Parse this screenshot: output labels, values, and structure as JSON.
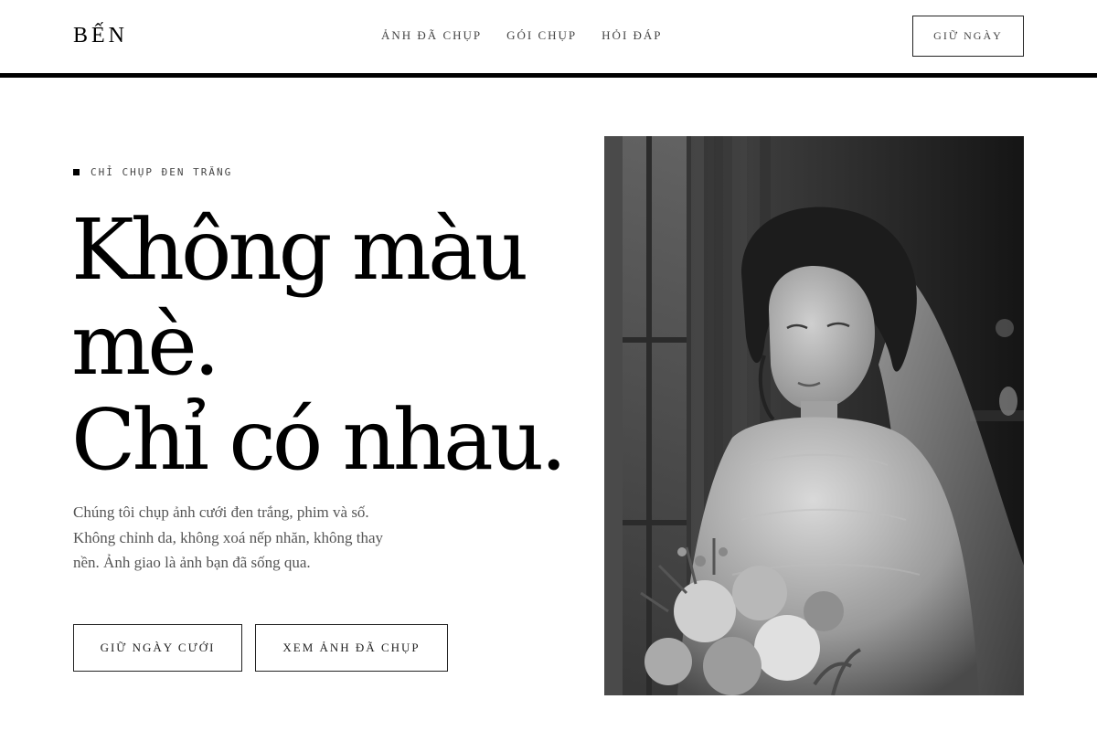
{
  "header": {
    "logo": "BẾN",
    "nav": [
      "ẢNH ĐÃ CHỤP",
      "GÓI CHỤP",
      "HỎI ĐÁP"
    ],
    "cta": "GIỮ NGÀY"
  },
  "hero": {
    "eyebrow": "CHỈ CHỤP ĐEN TRẮNG",
    "headline": [
      "Không màu",
      "mè.",
      "Chỉ có nhau."
    ],
    "lead": "Chúng tôi chụp ảnh cưới đen trắng, phim và số. Không chỉnh da, không xoá nếp nhăn, không thay nền. Ảnh giao là ảnh bạn đã sống qua.",
    "primary_button": "GIỮ NGÀY CƯỚI",
    "secondary_button": "XEM ẢNH ĐÃ CHỤP"
  },
  "colors": {
    "background": "#ffffff",
    "text": "#111111",
    "accent": "#000000"
  }
}
